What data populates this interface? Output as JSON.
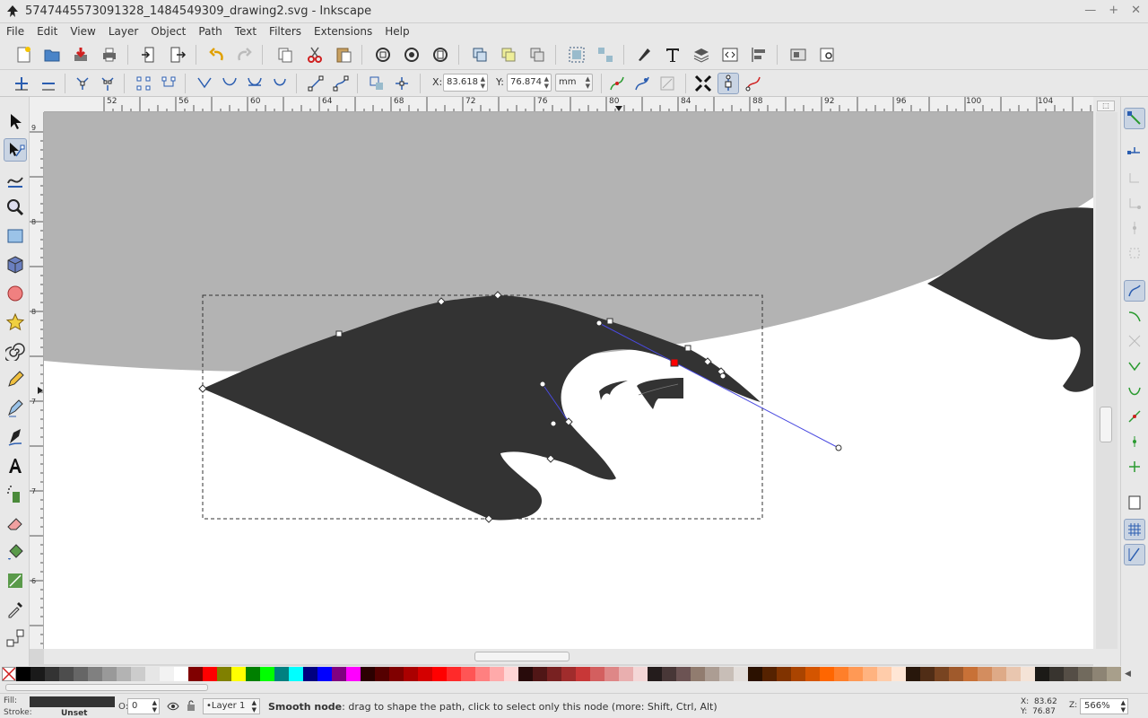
{
  "window": {
    "title": "5747445573091328_1484549309_drawing2.svg - Inkscape",
    "controls": [
      "—",
      "+",
      "✕"
    ]
  },
  "menu": [
    "File",
    "Edit",
    "View",
    "Layer",
    "Object",
    "Path",
    "Text",
    "Filters",
    "Extensions",
    "Help"
  ],
  "tool_controls": {
    "x_label": "X:",
    "x_value": "83.618",
    "y_label": "Y:",
    "y_value": "76.874",
    "unit": "mm"
  },
  "ruler": {
    "top_labels": [
      "52",
      "56",
      "60",
      "64",
      "68",
      "72",
      "76",
      "80",
      "84",
      "88",
      "92",
      "96",
      "100",
      "104"
    ],
    "left_labels": [
      "9",
      "8",
      "8",
      "7",
      "7",
      "6"
    ],
    "left_sub": [
      "0",
      "5",
      "0",
      "5",
      "0",
      "5"
    ]
  },
  "palette": {
    "colors": [
      "#000000",
      "#1a1a1a",
      "#333333",
      "#4d4d4d",
      "#666666",
      "#808080",
      "#999999",
      "#b3b3b3",
      "#cccccc",
      "#e6e6e6",
      "#f2f2f2",
      "#ffffff",
      "#800000",
      "#ff0000",
      "#808000",
      "#ffff00",
      "#008000",
      "#00ff00",
      "#008080",
      "#00ffff",
      "#000080",
      "#0000ff",
      "#800080",
      "#ff00ff",
      "#2b0000",
      "#550000",
      "#800000",
      "#aa0000",
      "#d40000",
      "#ff0000",
      "#ff2a2a",
      "#ff5555",
      "#ff8080",
      "#ffaaaa",
      "#ffd5d5",
      "#280b0b",
      "#501616",
      "#782121",
      "#a02c2c",
      "#c83737",
      "#d35f5f",
      "#de8787",
      "#e9afaf",
      "#f4d7d7",
      "#241c1c",
      "#483737",
      "#6c5353",
      "#917c6f",
      "#ac9d93",
      "#c8beb7",
      "#e3dedb",
      "#2b1100",
      "#552200",
      "#803300",
      "#aa4400",
      "#d45500",
      "#ff6600",
      "#ff7f2a",
      "#ff9955",
      "#ffb380",
      "#ffccaa",
      "#ffe6d5",
      "#28170b",
      "#502d16",
      "#784421",
      "#a05a2c",
      "#c87137",
      "#d38d5f",
      "#deaa87",
      "#e9c6af",
      "#f4e3d7",
      "#1c1a17",
      "#38342f",
      "#554e46",
      "#716a5d",
      "#8d8474",
      "#a89f8b"
    ]
  },
  "status": {
    "fill_label": "Fill:",
    "stroke_label": "Stroke:",
    "stroke_value": "Unset",
    "opacity_label": "O:",
    "opacity_value": "0",
    "layer": "•Layer 1",
    "message_bold": "Smooth node",
    "message_rest": ": drag to shape the path, click to select only this node (more: Shift, Ctrl, Alt)",
    "x_label": "X:",
    "x_value": "83.62",
    "y_label": "Y:",
    "y_value": "76.87",
    "zoom_label": "Z:",
    "zoom_value": "566%"
  },
  "colors": {
    "shape_fill": "#333333",
    "background_shape": "#b3b3b3",
    "selected_node": "#ff0000",
    "handle_line": "#4a4ae0"
  }
}
